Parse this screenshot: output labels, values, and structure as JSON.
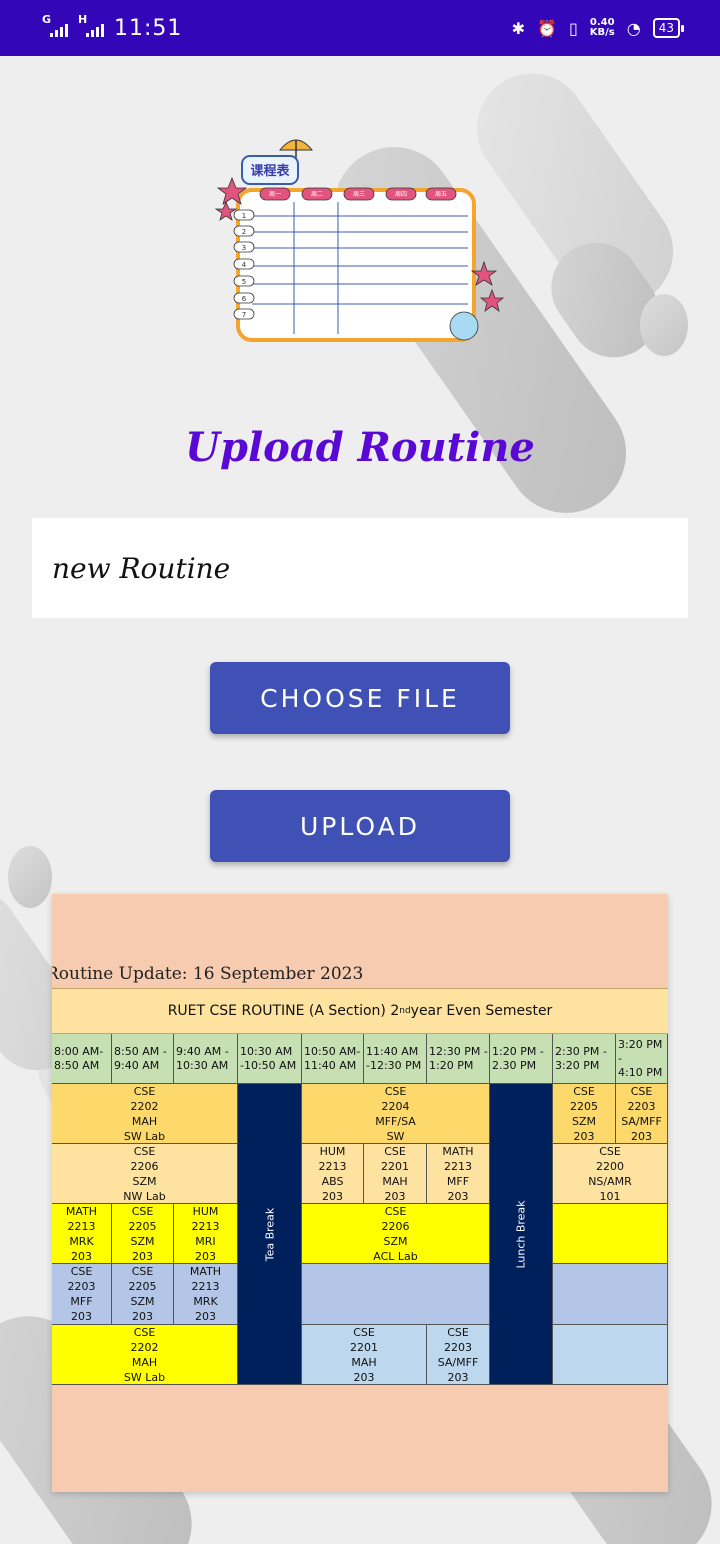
{
  "status_bar": {
    "net1": "G",
    "net2": "H",
    "time": "11:51",
    "speed_value": "0.40",
    "speed_unit": "KB/s",
    "battery": "43"
  },
  "illustration": {
    "badge": "课程表",
    "days": [
      "周一",
      "周二",
      "周三",
      "周四",
      "周五"
    ],
    "rows": [
      "1",
      "2",
      "3",
      "4",
      "5",
      "6",
      "7"
    ]
  },
  "title": "Upload Routine",
  "name_input": {
    "value": "new Routine"
  },
  "buttons": {
    "choose": "CHOOSE FILE",
    "upload": "UPLOAD"
  },
  "routine": {
    "update_line": "Routine Update: 16 September 2023",
    "heading_main": "RUET CSE ROUTINE (A Section) 2",
    "heading_sup": "nd",
    "heading_tail": " year Even Semester",
    "times": [
      "8:00 AM-\n8:50 AM",
      "8:50 AM -\n9:40 AM",
      "9:40 AM -\n10:30 AM",
      "10:30 AM\n-10:50 AM",
      "10:50 AM-\n11:40 AM",
      "11:40 AM\n-12:30 PM",
      "12:30 PM -\n1:20 PM",
      "1:20 PM -\n2.30 PM",
      "2:30 PM -\n3:20 PM",
      "3:20 PM -\n4:10 PM"
    ],
    "tea_break": "Tea Break",
    "lunch_break": "Lunch Break",
    "cells": [
      {
        "row": 0,
        "col": 0,
        "span": 3,
        "color": "#fdd96b",
        "text": "CSE\n2202\nMAH\nSW Lab"
      },
      {
        "row": 0,
        "col": 4,
        "span": 3,
        "color": "#fdd96b",
        "text": "CSE\n2204\nMFF/SA\nSW"
      },
      {
        "row": 0,
        "col": 8,
        "span": 1,
        "color": "#fdd96b",
        "text": "CSE\n2205\nSZM\n203"
      },
      {
        "row": 0,
        "col": 9,
        "span": 1,
        "color": "#fdd96b",
        "text": "CSE\n2203\nSA/MFF\n203"
      },
      {
        "row": 1,
        "col": 0,
        "span": 3,
        "color": "#fde2a0",
        "text": "CSE\n2206\nSZM\nNW Lab"
      },
      {
        "row": 1,
        "col": 4,
        "span": 1,
        "color": "#fde2a0",
        "text": "HUM\n2213\nABS\n203"
      },
      {
        "row": 1,
        "col": 5,
        "span": 1,
        "color": "#fde2a0",
        "text": "CSE\n2201\nMAH\n203"
      },
      {
        "row": 1,
        "col": 6,
        "span": 1,
        "color": "#fde2a0",
        "text": "MATH\n2213\nMFF\n203"
      },
      {
        "row": 1,
        "col": 8,
        "span": 2,
        "color": "#fde2a0",
        "text": "CSE\n2200\nNS/AMR\n101"
      },
      {
        "row": 2,
        "col": 0,
        "span": 1,
        "color": "#ffff00",
        "text": "MATH\n2213\nMRK\n203"
      },
      {
        "row": 2,
        "col": 1,
        "span": 1,
        "color": "#ffff00",
        "text": "CSE\n2205\nSZM\n203"
      },
      {
        "row": 2,
        "col": 2,
        "span": 1,
        "color": "#ffff00",
        "text": "HUM\n2213\nMRI\n203"
      },
      {
        "row": 2,
        "col": 4,
        "span": 3,
        "color": "#ffff00",
        "text": "CSE\n2206\nSZM\nACL Lab"
      },
      {
        "row": 2,
        "col": 8,
        "span": 2,
        "color": "#ffff00",
        "text": ""
      },
      {
        "row": 3,
        "col": 0,
        "span": 1,
        "color": "#b4c6e7",
        "text": "CSE\n2203\nMFF\n203"
      },
      {
        "row": 3,
        "col": 1,
        "span": 1,
        "color": "#b4c6e7",
        "text": "CSE\n2205\nSZM\n203"
      },
      {
        "row": 3,
        "col": 2,
        "span": 1,
        "color": "#b4c6e7",
        "text": "MATH\n2213\nMRK\n203"
      },
      {
        "row": 3,
        "col": 4,
        "span": 3,
        "color": "#b4c6e7",
        "text": ""
      },
      {
        "row": 3,
        "col": 8,
        "span": 2,
        "color": "#b4c6e7",
        "text": ""
      },
      {
        "row": 4,
        "col": 0,
        "span": 3,
        "color": "#ffff00",
        "text": "CSE\n2202\nMAH\nSW Lab"
      },
      {
        "row": 4,
        "col": 4,
        "span": 2,
        "color": "#bdd7ee",
        "text": "CSE\n2201\nMAH\n203"
      },
      {
        "row": 4,
        "col": 6,
        "span": 1,
        "color": "#bdd7ee",
        "text": "CSE\n2203\nSA/MFF\n203"
      },
      {
        "row": 4,
        "col": 8,
        "span": 2,
        "color": "#bdd7ee",
        "text": ""
      }
    ]
  }
}
